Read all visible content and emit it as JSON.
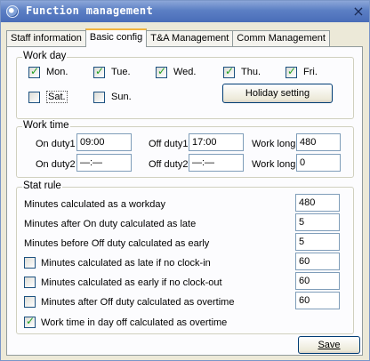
{
  "window": {
    "title": "Function management",
    "close_label": "×"
  },
  "tabs": [
    {
      "label": "Staff information"
    },
    {
      "label": "Basic config"
    },
    {
      "label": "T&A Management"
    },
    {
      "label": "Comm Management"
    }
  ],
  "active_tab": "Basic config",
  "work_day": {
    "legend": "Work day",
    "days": [
      {
        "label": "Mon.",
        "checked": true
      },
      {
        "label": "Tue.",
        "checked": true
      },
      {
        "label": "Wed.",
        "checked": true
      },
      {
        "label": "Thu.",
        "checked": true
      },
      {
        "label": "Fri.",
        "checked": true
      },
      {
        "label": "Sat.",
        "checked": false
      },
      {
        "label": "Sun.",
        "checked": false
      }
    ],
    "holiday_button": "Holiday setting"
  },
  "work_time": {
    "legend": "Work time",
    "on_duty1_label": "On duty1",
    "on_duty1_value": "09:00",
    "off_duty1_label": "Off duty1",
    "off_duty1_value": "17:00",
    "work_long1_label": "Work long",
    "work_long1_value": "480",
    "on_duty2_label": "On duty2",
    "on_duty2_value": "—:—",
    "off_duty2_label": "Off duty2",
    "off_duty2_value": "—:—",
    "work_long2_label": "Work long",
    "work_long2_value": "0"
  },
  "stat_rule": {
    "legend": "Stat rule",
    "rows": [
      {
        "label": "Minutes calculated as a workday",
        "value": "480",
        "has_checkbox": false
      },
      {
        "label": "Minutes after On duty calculated as late",
        "value": "5",
        "has_checkbox": false
      },
      {
        "label": "Minutes before Off duty calculated as early",
        "value": "5",
        "has_checkbox": false
      },
      {
        "label": "Minutes calculated as late if no clock-in",
        "value": "60",
        "has_checkbox": true,
        "checked": false
      },
      {
        "label": "Minutes calculated as early if no clock-out",
        "value": "60",
        "has_checkbox": true,
        "checked": false
      },
      {
        "label": "Minutes after Off duty calculated as overtime",
        "value": "60",
        "has_checkbox": true,
        "checked": false
      }
    ],
    "overtime_dayoff_label": "Work time in day off calculated as overtime",
    "overtime_dayoff_checked": true
  },
  "save_button": "Save",
  "colors": {
    "title_bar": "#4a6db8",
    "tab_active_accent": "#f2b33d",
    "check_mark": "#21a121"
  }
}
